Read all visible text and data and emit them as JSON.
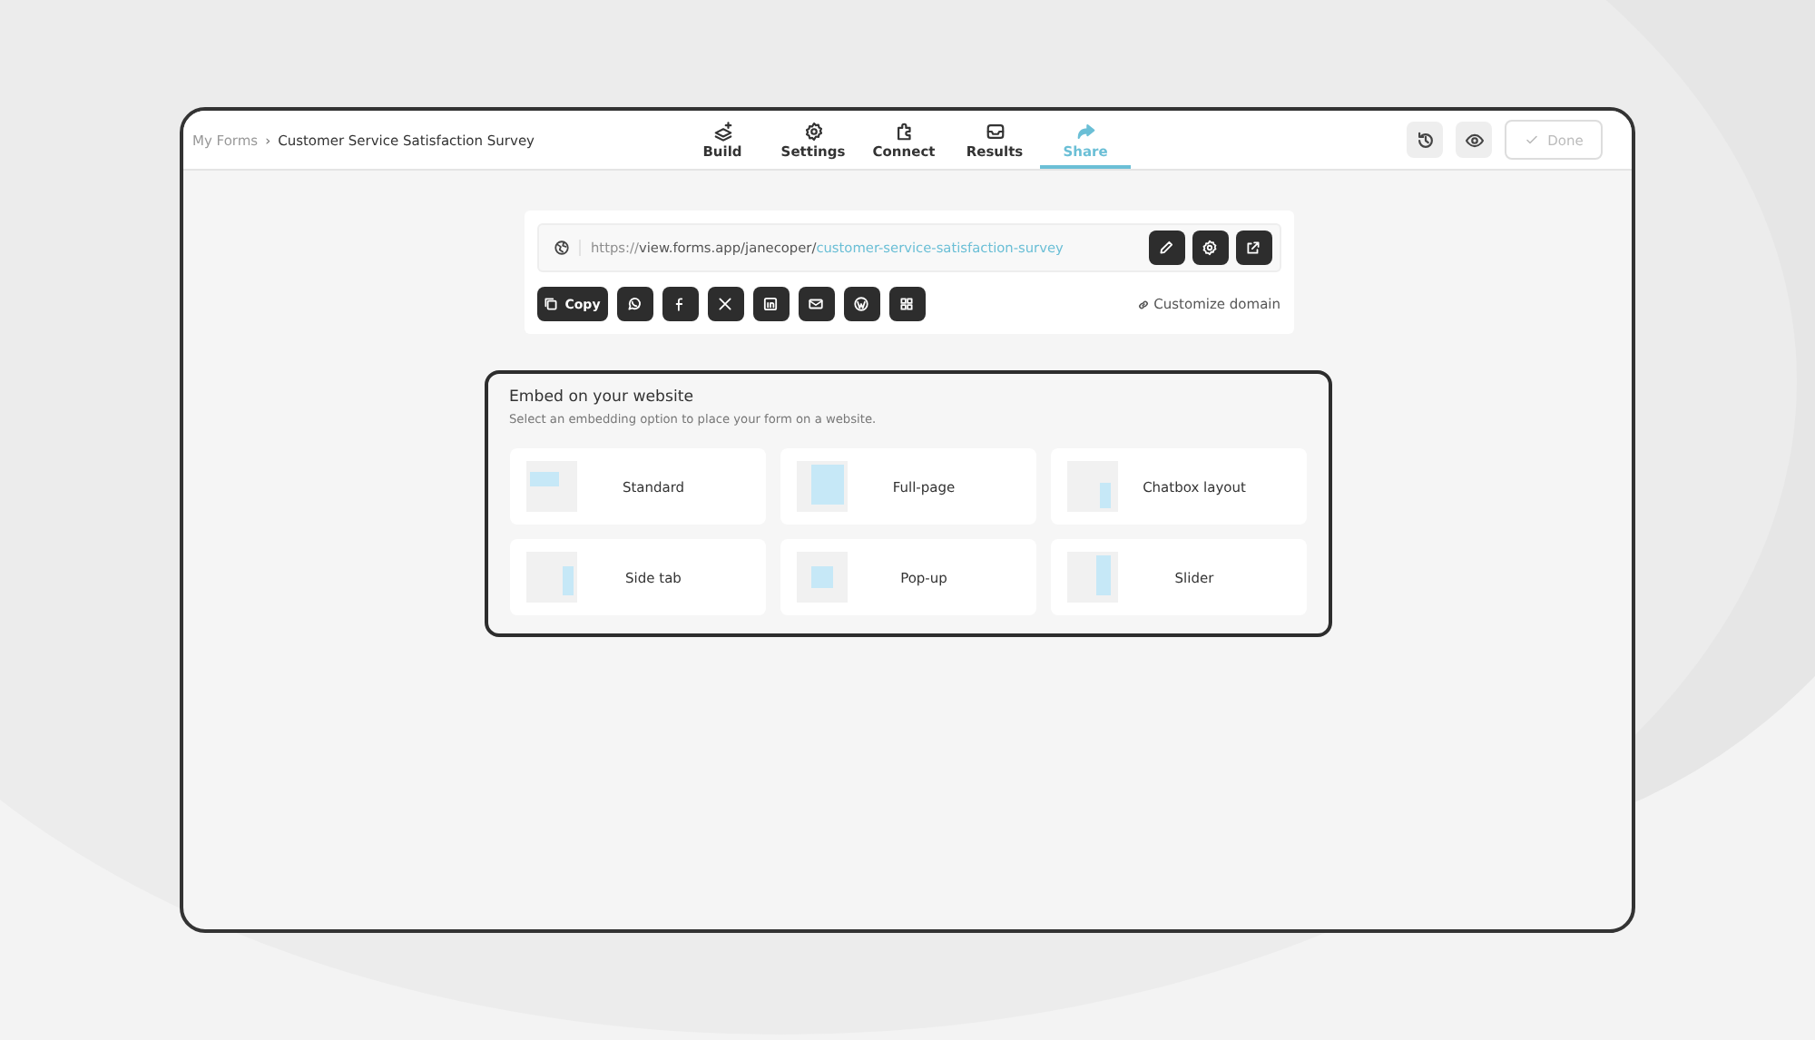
{
  "breadcrumb": {
    "parent": "My Forms",
    "separator": "›",
    "current": "Customer Service Satisfaction Survey"
  },
  "tabs": [
    {
      "label": "Build",
      "kind": "build",
      "selected": false
    },
    {
      "label": "Settings",
      "kind": "settings",
      "selected": false
    },
    {
      "label": "Connect",
      "kind": "connect",
      "selected": false
    },
    {
      "label": "Results",
      "kind": "results",
      "selected": false
    },
    {
      "label": "Share",
      "kind": "share",
      "selected": true
    }
  ],
  "done_button": {
    "label": "Done",
    "disabled": true
  },
  "share_link": {
    "scheme": "https://",
    "path": "view.forms.app/janecoper/",
    "slug": "customer-service-satisfaction-survey"
  },
  "copy_button": {
    "label": "Copy"
  },
  "share_buttons": [
    {
      "kind": "whatsapp"
    },
    {
      "kind": "facebook"
    },
    {
      "kind": "x"
    },
    {
      "kind": "linkedin"
    },
    {
      "kind": "email"
    },
    {
      "kind": "wordpress"
    },
    {
      "kind": "qr"
    }
  ],
  "customize_domain": "Customize domain",
  "embed": {
    "title": "Embed on your website",
    "subtitle": "Select an embedding option to place your form on a website.",
    "options": [
      {
        "label": "Standard",
        "kind": "standard"
      },
      {
        "label": "Full-page",
        "kind": "fullpage"
      },
      {
        "label": "Chatbox layout",
        "kind": "chatbox"
      },
      {
        "label": "Side tab",
        "kind": "sidetab"
      },
      {
        "label": "Pop-up",
        "kind": "popup"
      },
      {
        "label": "Slider",
        "kind": "slider"
      }
    ]
  }
}
